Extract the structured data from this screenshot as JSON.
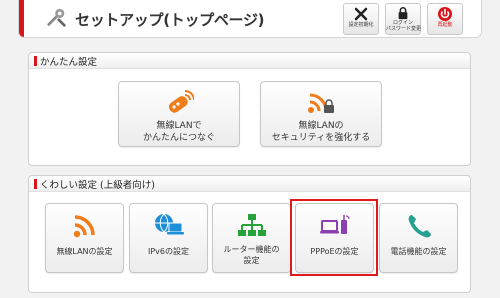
{
  "header": {
    "title": "セットアップ(トップページ)",
    "buttons": [
      {
        "label": "設定初期化",
        "icon": "tools-icon"
      },
      {
        "label": "ログイン\nパスワード変更",
        "icon": "lock-icon"
      },
      {
        "label": "再起動",
        "icon": "power-icon"
      }
    ]
  },
  "easy": {
    "title": "かんたん設定",
    "buttons": [
      {
        "label": "無線LANで\nかんたんにつなぐ",
        "icon": "remote-wifi-icon"
      },
      {
        "label": "無線LANの\nセキュリティを強化する",
        "icon": "wifi-lock-icon"
      }
    ]
  },
  "advanced": {
    "title": "くわしい設定 (上級者向け)",
    "tiles": [
      {
        "label": "無線LANの設定",
        "icon": "wifi-icon"
      },
      {
        "label": "IPv6の設定",
        "icon": "globe-laptop-icon"
      },
      {
        "label": "ルーター機能の\n設定",
        "icon": "network-icon"
      },
      {
        "label": "PPPoEの設定",
        "icon": "laptop-router-icon",
        "selected": true
      },
      {
        "label": "電話機能の設定",
        "icon": "phone-icon"
      }
    ]
  },
  "colors": {
    "accent": "#d7161b",
    "orange": "#f07c1a",
    "green": "#28a33c",
    "blue": "#1d8fd8",
    "purple": "#8b3fb0",
    "teal": "#27a090"
  }
}
